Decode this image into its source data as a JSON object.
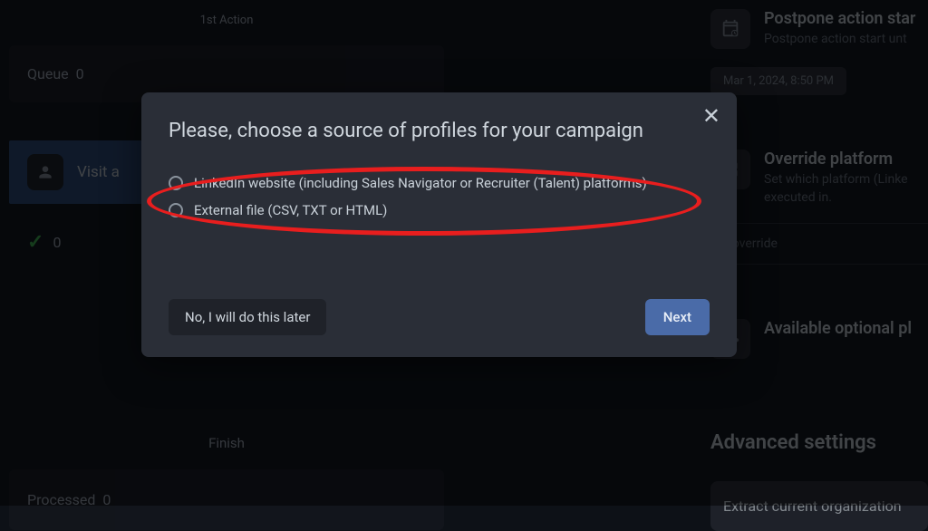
{
  "background": {
    "actionLabel": "1st Action",
    "queueLabel": "Queue",
    "queueCount": "0",
    "visitLabel": "Visit a",
    "checkCount": "0",
    "finishLabel": "Finish",
    "processedLabel": "Processed",
    "processedCount": "0"
  },
  "rightPanel": {
    "postpone": {
      "title": "Postpone action star",
      "sub": "Postpone action start unt",
      "date": "Mar 1, 2024, 8:50 PM"
    },
    "override": {
      "title": "Override platform",
      "sub": "Set which platform (Linke",
      "sub2": "executed in.",
      "status": "not override"
    },
    "available": {
      "title": "Available optional pl"
    },
    "advanced": "Advanced settings",
    "extract": "Extract current organization"
  },
  "modal": {
    "title": "Please, choose a source of profiles for your campaign",
    "option1": "LinkedIn website (including Sales Navigator or Recruiter (Talent) platforms)",
    "option2": "External file (CSV, TXT or HTML)",
    "laterBtn": "No, I will do this later",
    "nextBtn": "Next"
  }
}
